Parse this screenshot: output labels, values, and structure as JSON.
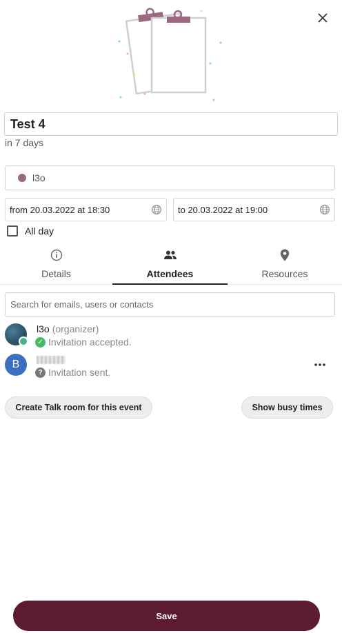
{
  "event": {
    "title": "Test 4",
    "relative_time": "in 7 days",
    "calendar_name": "l3o",
    "calendar_color": "#9b6a80",
    "start": "from 20.03.2022 at 18:30",
    "end": "to 20.03.2022 at 19:00",
    "all_day_label": "All day",
    "all_day_checked": false
  },
  "tabs": [
    {
      "label": "Details",
      "icon": "info-icon"
    },
    {
      "label": "Attendees",
      "icon": "people-icon",
      "active": true
    },
    {
      "label": "Resources",
      "icon": "location-pin-icon"
    }
  ],
  "attendees": {
    "search_placeholder": "Search for emails, users or contacts",
    "list": [
      {
        "name": "l3o",
        "role": "(organizer)",
        "status": "Invitation accepted.",
        "status_icon": "check-icon"
      },
      {
        "initial": "B",
        "status": "Invitation sent.",
        "status_icon": "question-icon"
      }
    ]
  },
  "actions": {
    "talk_room": "Create Talk room for this event",
    "busy_times": "Show busy times",
    "save": "Save"
  },
  "colors": {
    "primary": "#5c1a33",
    "accepted": "#46ba61",
    "avatar_b": "#3b6fbf"
  }
}
